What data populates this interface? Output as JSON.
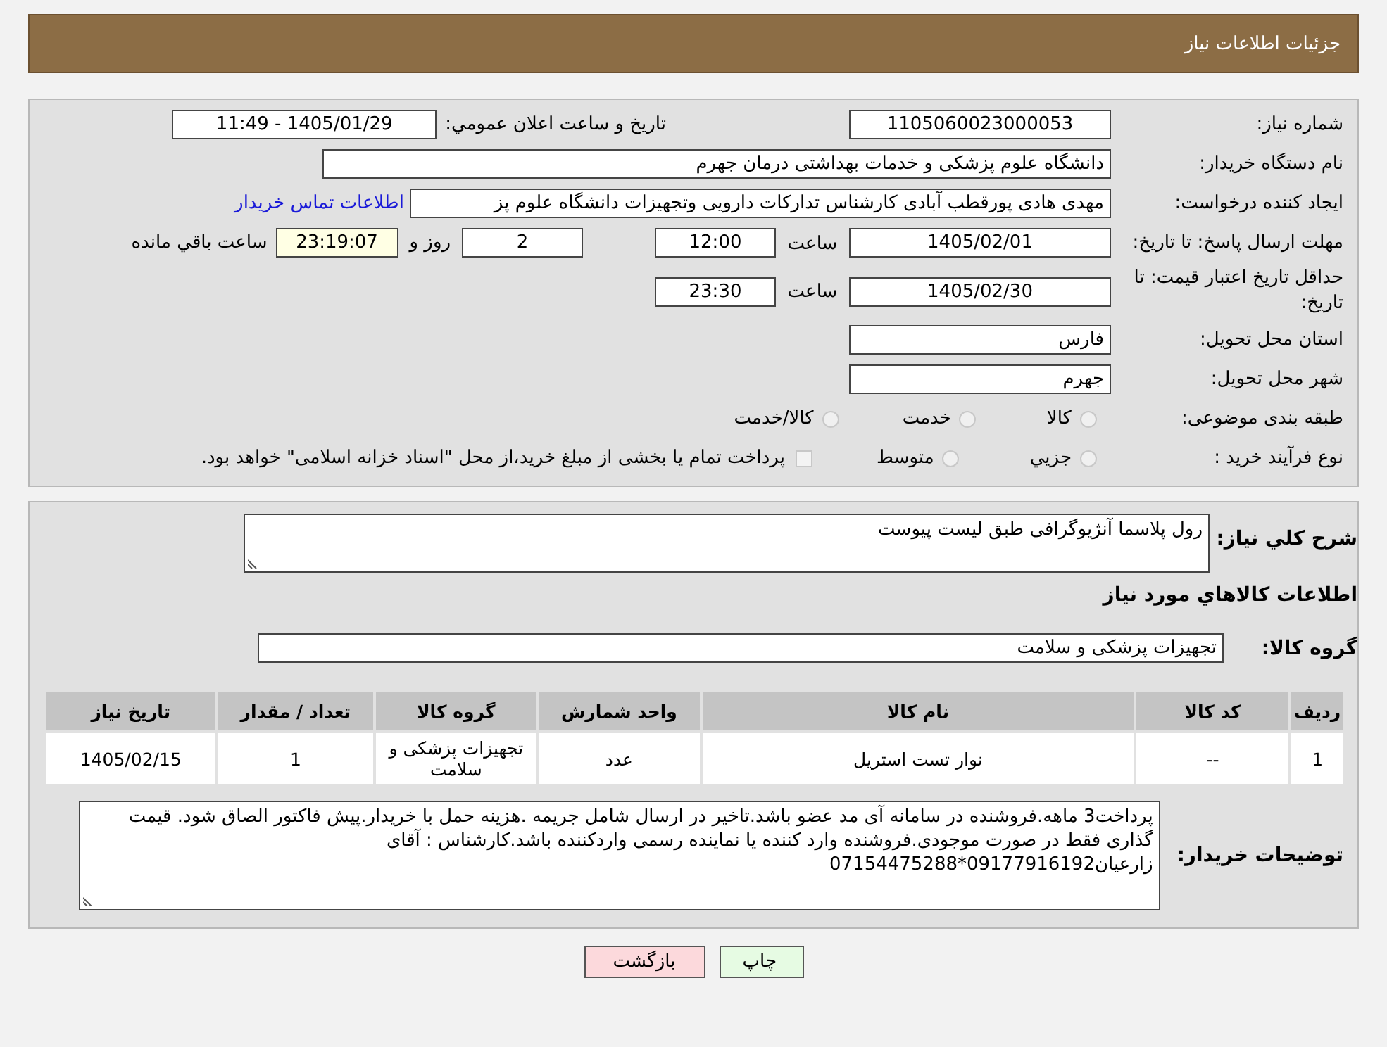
{
  "header": {
    "title": "جزئیات اطلاعات نیاز"
  },
  "details": {
    "need_number": {
      "label": "شماره نیاز:",
      "value": "1105060023000053"
    },
    "announce": {
      "label": "تاریخ و ساعت اعلان عمومي:",
      "value": "1405/01/29 - 11:49"
    },
    "buyer_org": {
      "label": "نام دستگاه خریدار:",
      "value": "دانشگاه علوم پزشکی و خدمات بهداشتی  درمان جهرم"
    },
    "requester": {
      "label": "ایجاد کننده درخواست:",
      "value": "مهدی هادی پورقطب آبادی کارشناس تدارکات دارویی وتجهیزات دانشگاه علوم پز",
      "link": "اطلاعات تماس خریدار"
    },
    "reply_deadline": {
      "label": "مهلت ارسال پاسخ: تا تاریخ:",
      "date": "1405/02/01",
      "time_label": "ساعت",
      "time": "12:00",
      "days": "2",
      "days_label": "روز و",
      "remaining": "23:19:07",
      "remaining_label": "ساعت باقي مانده"
    },
    "price_validity": {
      "label": "حداقل تاریخ اعتبار قیمت: تا تاریخ:",
      "date": "1405/02/30",
      "time_label": "ساعت",
      "time": "23:30"
    },
    "province": {
      "label": "استان محل تحویل:",
      "value": "فارس"
    },
    "city": {
      "label": "شهر محل تحویل:",
      "value": "جهرم"
    },
    "category": {
      "label": "طبقه بندی موضوعی:",
      "options": [
        {
          "label": "کالا",
          "selected": false
        },
        {
          "label": "خدمت",
          "selected": false
        },
        {
          "label": "کالا/خدمت",
          "selected": false
        }
      ]
    },
    "process": {
      "label": "نوع فرآیند خرید :",
      "options": [
        {
          "label": "جزيي",
          "selected": false
        },
        {
          "label": "متوسط",
          "selected": false
        }
      ],
      "payment": {
        "checked": false,
        "text": "پرداخت تمام یا بخشی از مبلغ خرید،از محل \"اسناد خزانه اسلامی\" خواهد بود."
      }
    }
  },
  "needs": {
    "summary": {
      "label": "شرح کلي نیاز:",
      "value": "رول پلاسما آنژیوگرافی طبق لیست پیوست"
    },
    "section_title": "اطلاعات کالاهاي مورد نیاز",
    "group": {
      "label": "گروه کالا:",
      "value": "تجهیزات پزشکی و سلامت"
    },
    "table": {
      "columns": [
        "ردیف",
        "کد کالا",
        "نام کالا",
        "واحد شمارش",
        "گروه کالا",
        "تعداد / مقدار",
        "تاریخ نیاز"
      ],
      "rows": [
        [
          "1",
          "--",
          "نوار تست استریل",
          "عدد",
          "تجهیزات پزشکی و سلامت",
          "1",
          "1405/02/15"
        ]
      ]
    },
    "buyer_notes": {
      "label": "توضیحات خریدار:",
      "value": "پرداخت3 ماهه.فروشنده در سامانه آی مد عضو باشد.تاخیر در ارسال شامل جریمه .هزینه حمل با خریدار.پیش فاکتور الصاق شود. قیمت گذاری فقط در صورت موجودی.فروشنده وارد کننده یا نماینده رسمی واردکننده باشد.کارشناس : آقای زارعیان09177916192*07154475288"
    }
  },
  "buttons": [
    {
      "label": "چاپ",
      "kind": "print"
    },
    {
      "label": "بازگشت",
      "kind": "back"
    }
  ]
}
